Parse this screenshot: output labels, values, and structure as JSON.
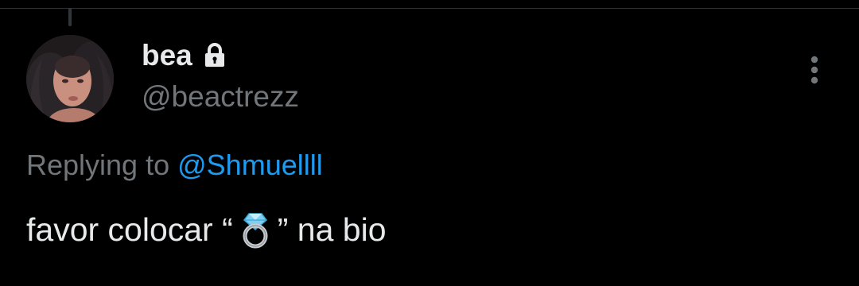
{
  "tweet": {
    "author": {
      "display_name": "bea",
      "handle": "@beactrezz",
      "protected_icon": "lock-icon",
      "avatar": "profile-photo"
    },
    "reply_context": {
      "prefix": "Replying to",
      "mention": "@Shmuellll"
    },
    "text": {
      "before_emoji": "favor colocar “",
      "emoji": "ring-emoji",
      "after_emoji": "” na bio"
    },
    "more_menu_icon": "more-vertical-icon"
  },
  "colors": {
    "background": "#000000",
    "primary_text": "#e7e9ea",
    "secondary_text": "#71767b",
    "link": "#1d9bf0",
    "divider": "#2f3336"
  }
}
